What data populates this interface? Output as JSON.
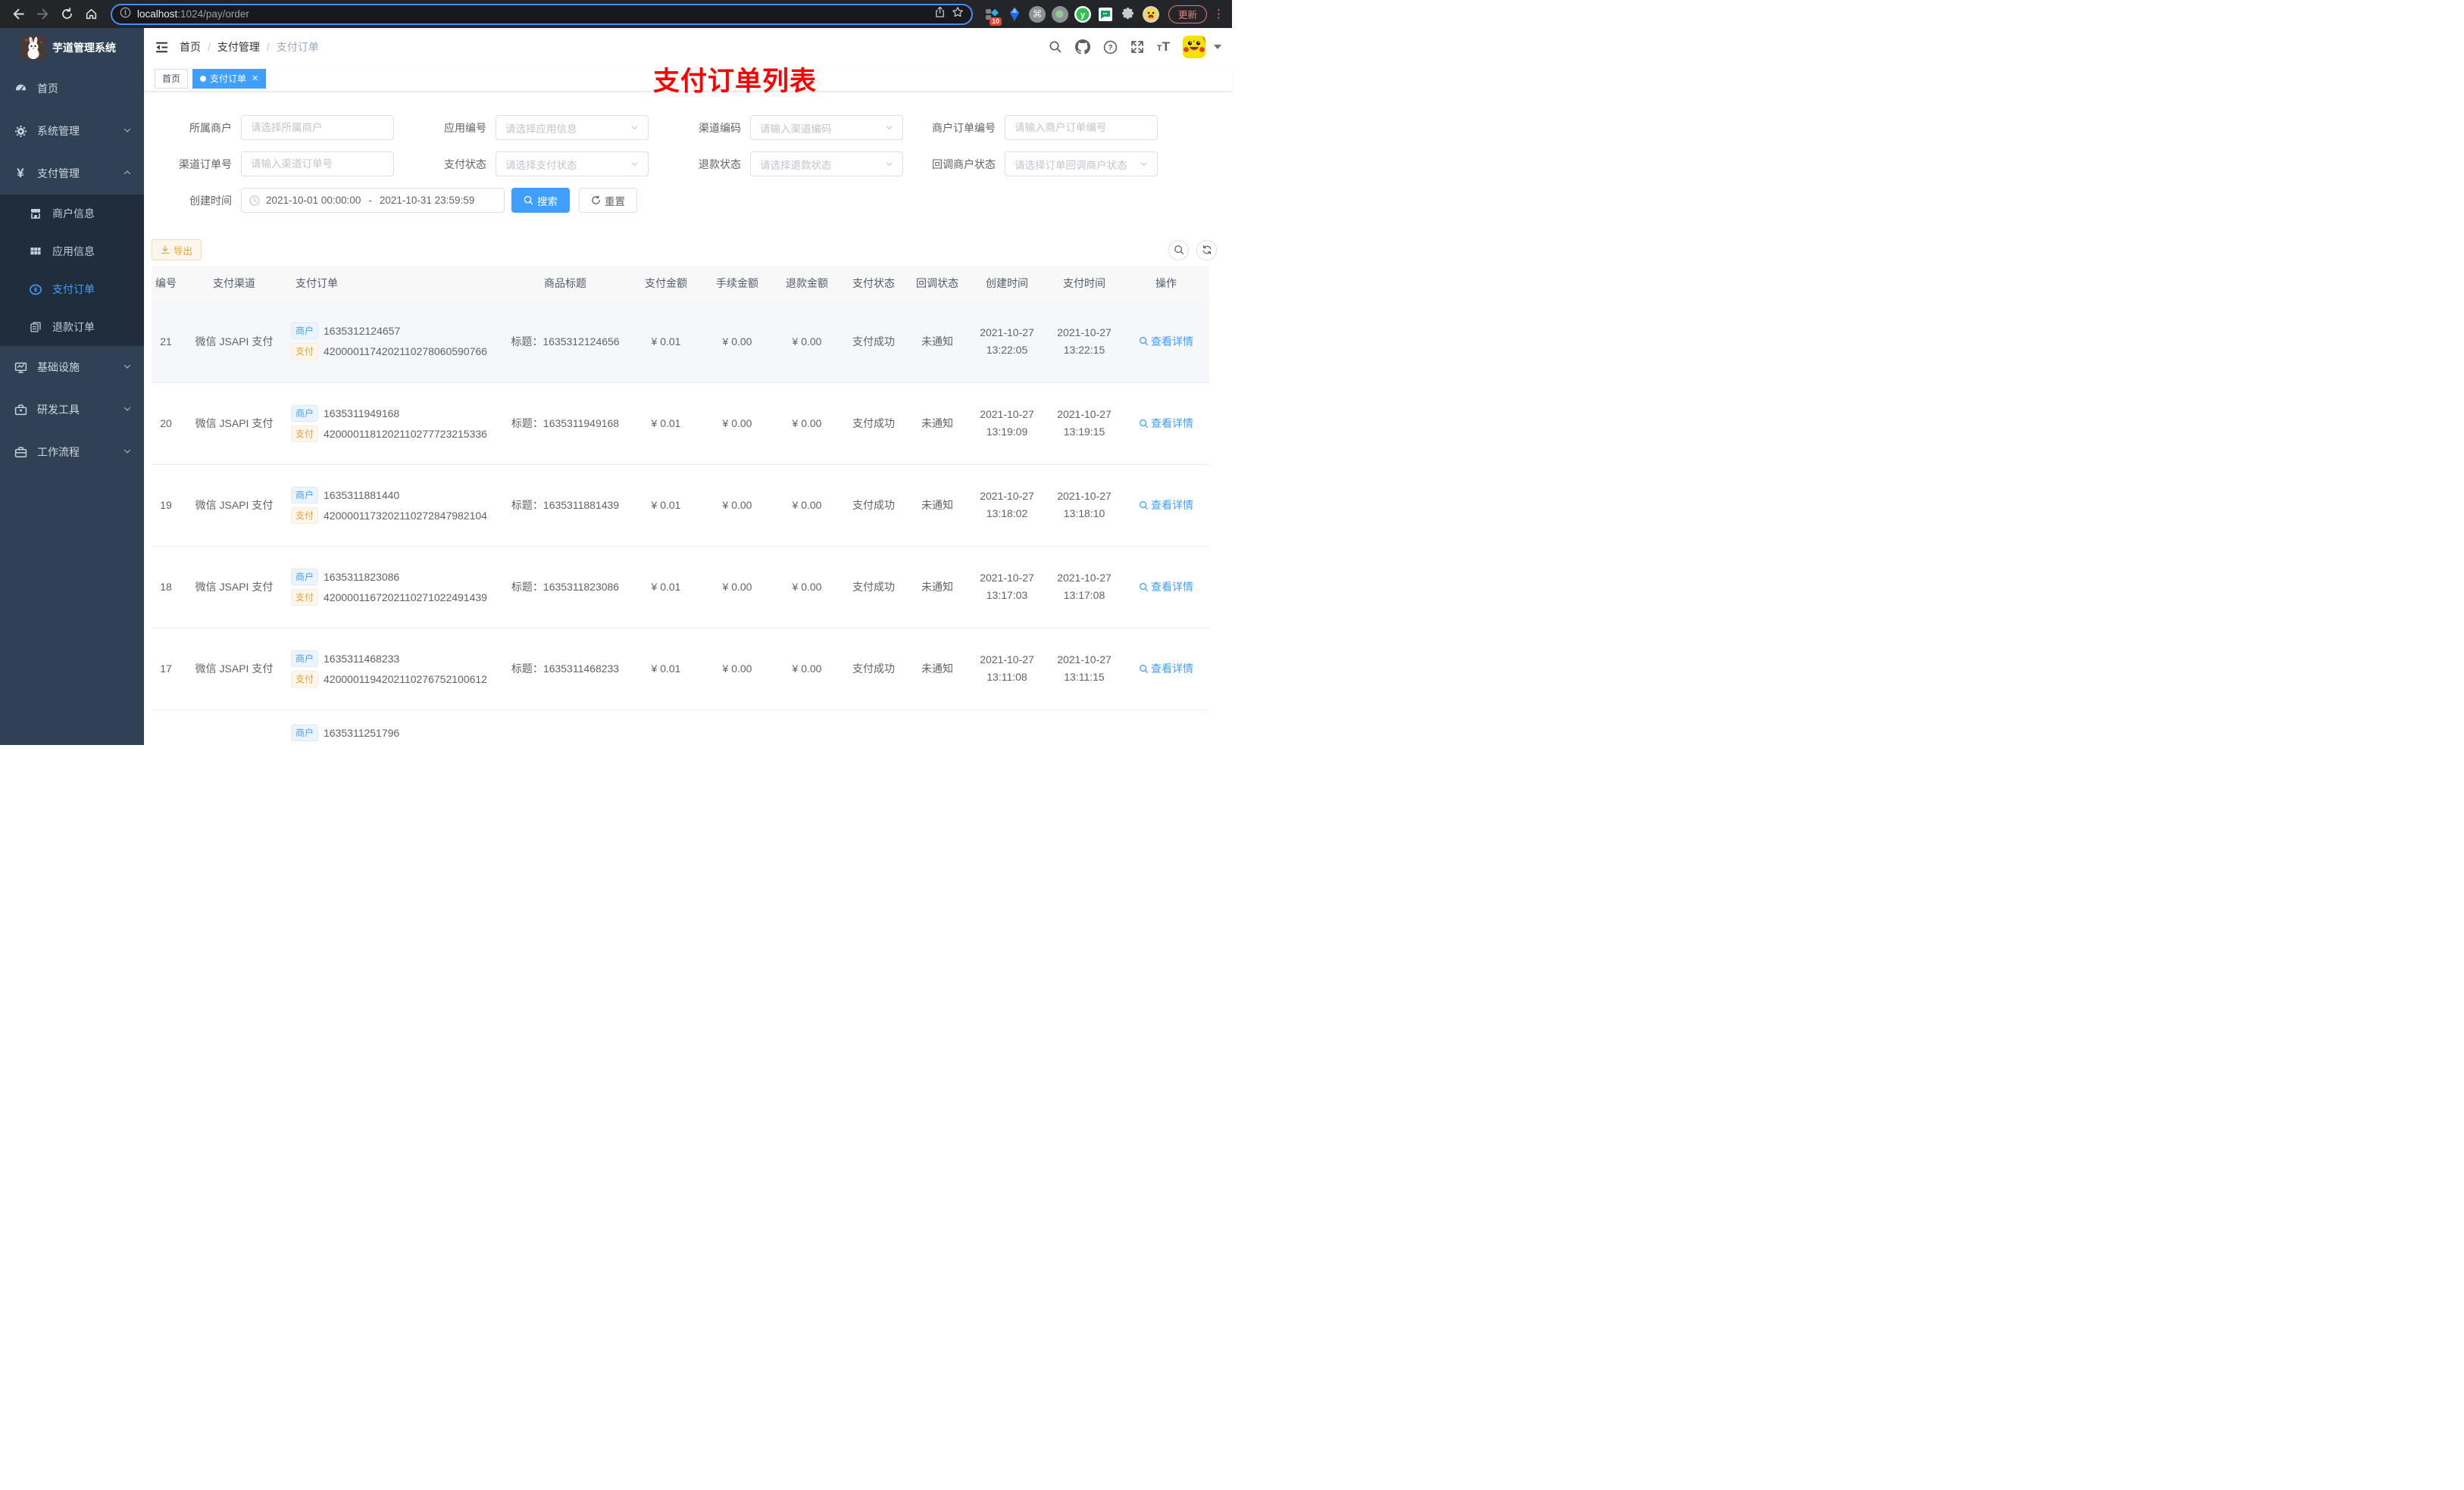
{
  "browser": {
    "url_host": "localhost",
    "url_path": ":1024/pay/order",
    "extension_badge": "10",
    "update_label": "更新"
  },
  "sidebar": {
    "title": "芋道管理系统",
    "menu": [
      {
        "label": "首页"
      },
      {
        "label": "系统管理"
      },
      {
        "label": "支付管理"
      },
      {
        "label": "商户信息"
      },
      {
        "label": "应用信息"
      },
      {
        "label": "支付订单"
      },
      {
        "label": "退款订单"
      },
      {
        "label": "基础设施"
      },
      {
        "label": "研发工具"
      },
      {
        "label": "工作流程"
      }
    ]
  },
  "header": {
    "breadcrumb": [
      "首页",
      "支付管理",
      "支付订单"
    ],
    "annotation": "支付订单列表"
  },
  "tags": {
    "items": [
      {
        "label": "首页",
        "active": false
      },
      {
        "label": "支付订单",
        "active": true
      }
    ]
  },
  "filters": {
    "fields": [
      {
        "label": "所属商户",
        "placeholder": "请选择所属商户",
        "type": "input"
      },
      {
        "label": "应用编号",
        "placeholder": "请选择应用信息",
        "type": "select"
      },
      {
        "label": "渠道编码",
        "placeholder": "请输入渠道编码",
        "type": "select"
      },
      {
        "label": "商户订单编号",
        "placeholder": "请输入商户订单编号",
        "type": "input"
      },
      {
        "label": "渠道订单号",
        "placeholder": "请输入渠道订单号",
        "type": "input"
      },
      {
        "label": "支付状态",
        "placeholder": "请选择支付状态",
        "type": "select"
      },
      {
        "label": "退款状态",
        "placeholder": "请选择退款状态",
        "type": "select"
      },
      {
        "label": "回调商户状态",
        "placeholder": "请选择订单回调商户状态",
        "type": "select"
      }
    ],
    "date": {
      "label": "创建时间",
      "start": "2021-10-01 00:00:00",
      "separator": "-",
      "end": "2021-10-31 23:59:59"
    },
    "search_label": "搜索",
    "reset_label": "重置"
  },
  "toolbar": {
    "export_label": "导出"
  },
  "table": {
    "columns": [
      "编号",
      "支付渠道",
      "支付订单",
      "商品标题",
      "支付金额",
      "手续金额",
      "退款金额",
      "支付状态",
      "回调状态",
      "创建时间",
      "支付时间",
      "操作"
    ],
    "tag_merchant": "商户",
    "tag_pay": "支付",
    "rows": [
      {
        "id": "21",
        "channel": "微信 JSAPI 支付",
        "merchant_no": "1635312124657",
        "pay_no": "4200001174202110278060590766",
        "title": "标题：1635312124656",
        "amount": "¥ 0.01",
        "fee": "¥ 0.00",
        "refund": "¥ 0.00",
        "status": "支付成功",
        "notify": "未通知",
        "create_time": "2021-10-27 13:22:05",
        "pay_time": "2021-10-27 13:22:15",
        "action": "查看详情",
        "highlight": true,
        "partial": false
      },
      {
        "id": "20",
        "channel": "微信 JSAPI 支付",
        "merchant_no": "1635311949168",
        "pay_no": "4200001181202110277723215336",
        "title": "标题：1635311949168",
        "amount": "¥ 0.01",
        "fee": "¥ 0.00",
        "refund": "¥ 0.00",
        "status": "支付成功",
        "notify": "未通知",
        "create_time": "2021-10-27 13:19:09",
        "pay_time": "2021-10-27 13:19:15",
        "action": "查看详情",
        "highlight": false,
        "partial": false
      },
      {
        "id": "19",
        "channel": "微信 JSAPI 支付",
        "merchant_no": "1635311881440",
        "pay_no": "4200001173202110272847982104",
        "title": "标题：1635311881439",
        "amount": "¥ 0.01",
        "fee": "¥ 0.00",
        "refund": "¥ 0.00",
        "status": "支付成功",
        "notify": "未通知",
        "create_time": "2021-10-27 13:18:02",
        "pay_time": "2021-10-27 13:18:10",
        "action": "查看详情",
        "highlight": false,
        "partial": false
      },
      {
        "id": "18",
        "channel": "微信 JSAPI 支付",
        "merchant_no": "1635311823086",
        "pay_no": "4200001167202110271022491439",
        "title": "标题：1635311823086",
        "amount": "¥ 0.01",
        "fee": "¥ 0.00",
        "refund": "¥ 0.00",
        "status": "支付成功",
        "notify": "未通知",
        "create_time": "2021-10-27 13:17:03",
        "pay_time": "2021-10-27 13:17:08",
        "action": "查看详情",
        "highlight": false,
        "partial": false
      },
      {
        "id": "17",
        "channel": "微信 JSAPI 支付",
        "merchant_no": "1635311468233",
        "pay_no": "4200001194202110276752100612",
        "title": "标题：1635311468233",
        "amount": "¥ 0.01",
        "fee": "¥ 0.00",
        "refund": "¥ 0.00",
        "status": "支付成功",
        "notify": "未通知",
        "create_time": "2021-10-27 13:11:08",
        "pay_time": "2021-10-27 13:11:15",
        "action": "查看详情",
        "highlight": false,
        "partial": false
      },
      {
        "id": "",
        "channel": "",
        "merchant_no": "1635311251796",
        "pay_no": "",
        "title": "",
        "amount": "",
        "fee": "",
        "refund": "",
        "status": "",
        "notify": "",
        "create_time": "",
        "pay_time": "",
        "action": "",
        "highlight": false,
        "partial": true
      }
    ]
  }
}
